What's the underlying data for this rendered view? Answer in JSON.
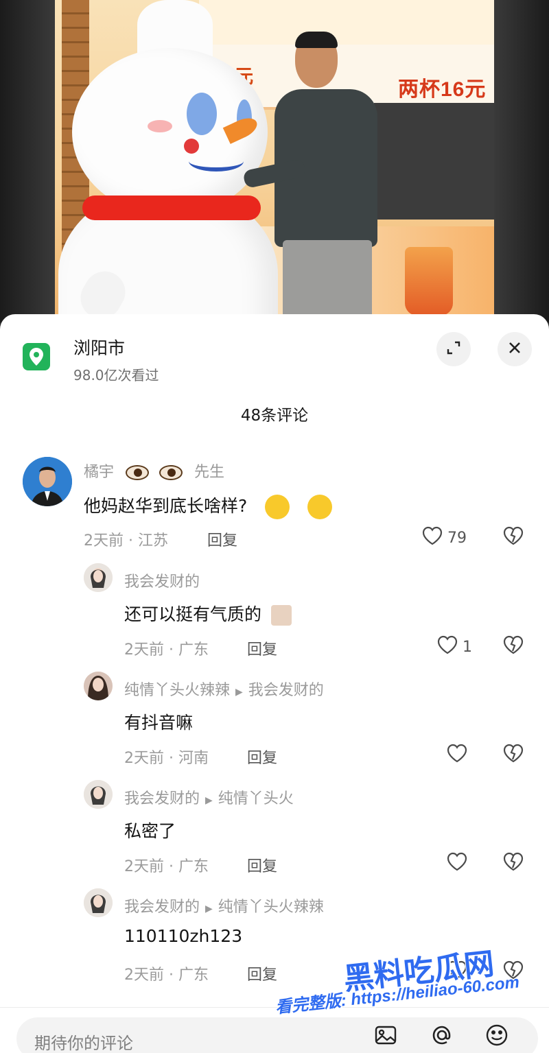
{
  "location": {
    "name": "浏阳市",
    "views": "98.0亿次看过"
  },
  "comments_count": "48条评论",
  "comments": [
    {
      "user": "橘宇",
      "user_extra": "先生",
      "text": "他妈赵华到底长啥样?",
      "time_region": "2天前 · 江苏",
      "reply": "回复",
      "likes": "79"
    },
    {
      "user": "我会发财的",
      "text": "还可以挺有气质的",
      "time_region": "2天前 · 广东",
      "reply": "回复",
      "likes": "1"
    },
    {
      "user": "纯情丫头火辣辣",
      "to": "我会发财的",
      "text": "有抖音嘛",
      "time_region": "2天前 · 河南",
      "reply": "回复"
    },
    {
      "user": "我会发财的",
      "to": "纯情丫头火",
      "text": "私密了",
      "time_region": "2天前 · 广东",
      "reply": "回复"
    },
    {
      "user": "我会发财的",
      "to": "纯情丫头火辣辣",
      "text": "110110zh123",
      "time_region": "2天前 · 广东",
      "reply": "回复"
    }
  ],
  "input": {
    "placeholder": "期待你的评论"
  },
  "photo": {
    "sign_left": "16元",
    "sign_right": "两杯16元"
  },
  "watermark": {
    "title": "黑料吃瓜网",
    "subtitle": "看完整版: https://heiliao-60.com"
  },
  "colors": {
    "location_green": "#22b35a",
    "watermark_blue": "#2f6bf0"
  },
  "icons": [
    "location-pin-icon",
    "collapse-icon",
    "close-icon",
    "heart-icon",
    "broken-heart-icon",
    "image-icon",
    "at-icon",
    "emoji-icon"
  ]
}
